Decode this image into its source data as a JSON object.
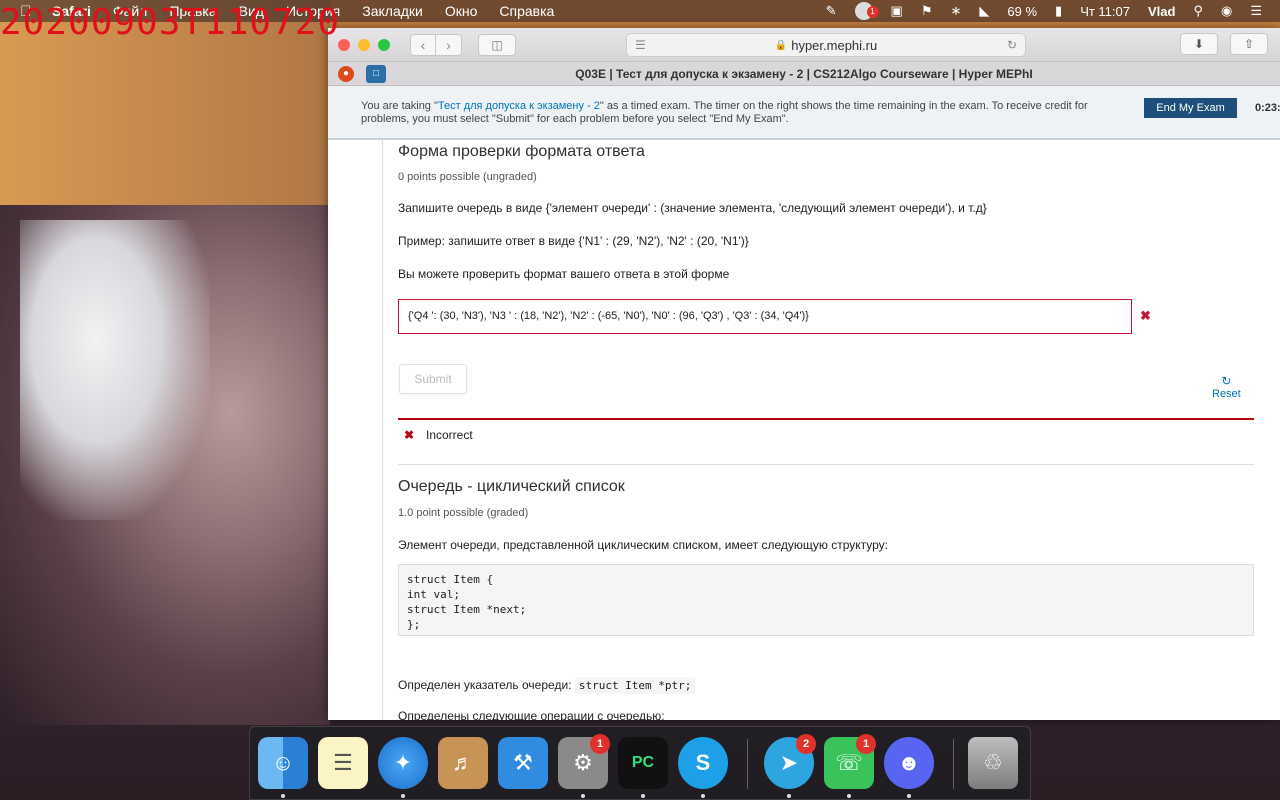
{
  "webcam": {
    "timestamp": "20200903T110720"
  },
  "menubar": {
    "items": [
      "Safari",
      "Файл",
      "Правка",
      "Вид",
      "История",
      "Закладки",
      "Окно",
      "Справка"
    ],
    "battery": "69 %",
    "clock": "Чт 11:07",
    "user": "Vlad",
    "notif_badge": "1"
  },
  "browser": {
    "url": "hyper.mephi.ru",
    "tab_title": "Q03E | Тест для допуска к экзамену - 2 | CS212Algo Courseware | Hyper MEPhI"
  },
  "exam_banner": {
    "msg_prefix": "You are taking \"",
    "exam_link": "Тест для допуска к экзамену - 2",
    "msg_suffix": "\" as a timed exam. The timer on the right shows the time remaining in the exam. To receive credit for problems, you must select \"Submit\" for each problem before you select \"End My Exam\".",
    "end_button": "End My Exam",
    "timer": "0:23:"
  },
  "problem1": {
    "title": "Форма проверки формата ответа",
    "points": "0 points possible (ungraded)",
    "text1": "Запишите очередь в виде {'элемент очереди' : (значение элемента, 'следующий элемент очереди'), и т.д}",
    "text2": "Пример: запишите ответ в виде {'N1' : (29, 'N2'), 'N2' : (20, 'N1')}",
    "text3": "Вы можете проверить формат вашего ответа в этой форме",
    "answer": "{'Q4 ': (30, 'N3'), 'N3 ' : (18, 'N2'), 'N2' : (-65, 'N0'), 'N0' : (96, 'Q3') , 'Q3' : (34, 'Q4')}",
    "submit": "Submit",
    "reset": "Reset",
    "status": "Incorrect"
  },
  "problem2": {
    "title": "Очередь - циклический список",
    "points": "1.0 point possible (graded)",
    "text1": "Элемент очереди, представленной циклическим списком, имеет следующую структуру:",
    "code": "struct Item {\nint val;\nstruct Item *next;\n};",
    "text2_prefix": "Определен указатель очереди:",
    "text2_code": "struct Item *ptr;",
    "text3": "Определены следующие операции с очередью:"
  },
  "dock": {
    "badges": {
      "system_prefs": "1",
      "telegram": "2",
      "facetime": "1"
    }
  }
}
